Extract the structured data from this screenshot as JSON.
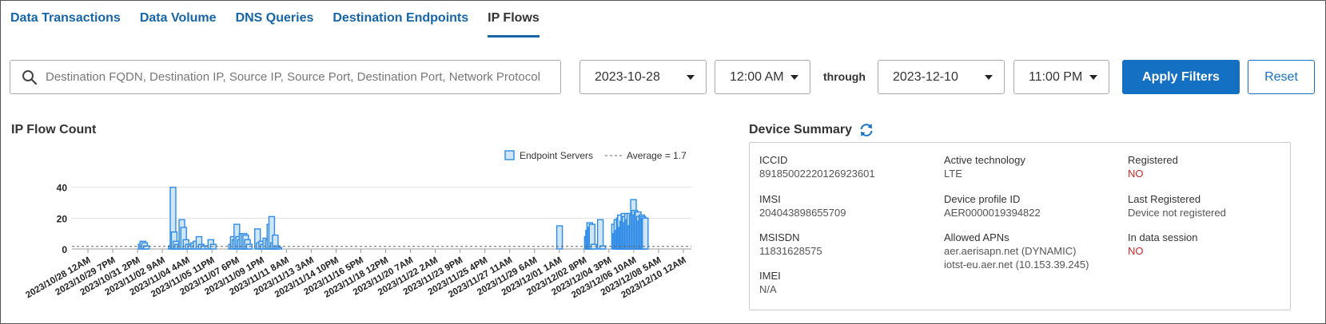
{
  "tabs": [
    {
      "label": "Data Transactions",
      "active": false
    },
    {
      "label": "Data Volume",
      "active": false
    },
    {
      "label": "DNS Queries",
      "active": false
    },
    {
      "label": "Destination Endpoints",
      "active": false
    },
    {
      "label": "IP Flows",
      "active": true
    }
  ],
  "filters": {
    "search_placeholder": "Destination FQDN, Destination IP, Source IP, Source Port, Destination Port, Network Protocol",
    "start_date": "2023-10-28",
    "start_time": "12:00 AM",
    "through_label": "through",
    "end_date": "2023-12-10",
    "end_time": "11:00 PM",
    "apply_label": "Apply Filters",
    "reset_label": "Reset"
  },
  "chart": {
    "title": "IP Flow Count"
  },
  "chart_data": {
    "type": "bar",
    "title": "IP Flow Count",
    "legend": [
      {
        "name": "Endpoint Servers",
        "style": "bar"
      },
      {
        "name": "Average = 1.7",
        "style": "dashed-line"
      }
    ],
    "legend_position": "top-right",
    "ylim": [
      0,
      45
    ],
    "yticks": [
      0,
      20,
      40
    ],
    "grid": true,
    "x_tick_labels": [
      "2023/10/28 12AM",
      "2023/10/29 7PM",
      "2023/10/31 2PM",
      "2023/11/02 9AM",
      "2023/11/04 4AM",
      "2023/11/05 11PM",
      "2023/11/07 6PM",
      "2023/11/09 1PM",
      "2023/11/11 8AM",
      "2023/11/13 3AM",
      "2023/11/14 10PM",
      "2023/11/16 5PM",
      "2023/11/18 12PM",
      "2023/11/20 7AM",
      "2023/11/22 2AM",
      "2023/11/23 9PM",
      "2023/11/25 4PM",
      "2023/11/27 11AM",
      "2023/11/29 6AM",
      "2023/12/01 1AM",
      "2023/12/02 8PM",
      "2023/12/04 3PM",
      "2023/12/06 10AM",
      "2023/12/08 5AM",
      "2023/12/10 12AM"
    ],
    "x_range": [
      0,
      1048
    ],
    "x_unit": "hours since 2023/10/28 12AM",
    "series": [
      {
        "name": "Endpoint Servers",
        "points": [
          [
            117,
            3
          ],
          [
            120,
            5
          ],
          [
            123,
            4
          ],
          [
            126,
            2
          ],
          [
            168,
            2
          ],
          [
            171,
            40
          ],
          [
            173,
            11
          ],
          [
            176,
            5
          ],
          [
            179,
            3
          ],
          [
            183,
            2
          ],
          [
            186,
            19
          ],
          [
            189,
            14
          ],
          [
            193,
            6
          ],
          [
            197,
            3
          ],
          [
            201,
            2
          ],
          [
            206,
            4
          ],
          [
            210,
            5
          ],
          [
            215,
            8
          ],
          [
            219,
            3
          ],
          [
            223,
            2
          ],
          [
            230,
            2
          ],
          [
            235,
            6
          ],
          [
            239,
            3
          ],
          [
            270,
            3
          ],
          [
            273,
            8
          ],
          [
            276,
            6
          ],
          [
            279,
            16
          ],
          [
            282,
            8
          ],
          [
            285,
            6
          ],
          [
            288,
            10
          ],
          [
            291,
            10
          ],
          [
            294,
            9
          ],
          [
            297,
            6
          ],
          [
            300,
            3
          ],
          [
            314,
            13
          ],
          [
            317,
            4
          ],
          [
            321,
            5
          ],
          [
            324,
            3
          ],
          [
            328,
            7
          ],
          [
            332,
            6
          ],
          [
            335,
            16
          ],
          [
            338,
            21
          ],
          [
            341,
            4
          ],
          [
            344,
            9
          ],
          [
            347,
            2
          ],
          [
            350,
            1
          ],
          [
            825,
            15
          ],
          [
            872,
            8
          ],
          [
            874,
            12
          ],
          [
            876,
            17
          ],
          [
            878,
            14
          ],
          [
            880,
            16
          ],
          [
            883,
            3
          ],
          [
            894,
            19
          ],
          [
            898,
            2
          ],
          [
            918,
            16
          ],
          [
            920,
            10
          ],
          [
            922,
            19
          ],
          [
            924,
            12
          ],
          [
            926,
            20
          ],
          [
            928,
            22
          ],
          [
            930,
            14
          ],
          [
            932,
            18
          ],
          [
            934,
            23
          ],
          [
            936,
            21
          ],
          [
            938,
            17
          ],
          [
            940,
            23
          ],
          [
            942,
            19
          ],
          [
            944,
            23
          ],
          [
            946,
            15
          ],
          [
            948,
            22
          ],
          [
            950,
            32
          ],
          [
            952,
            25
          ],
          [
            954,
            22
          ],
          [
            956,
            24
          ],
          [
            958,
            24
          ],
          [
            960,
            21
          ],
          [
            962,
            18
          ],
          [
            964,
            22
          ],
          [
            966,
            21
          ],
          [
            968,
            20
          ],
          [
            970,
            20
          ]
        ]
      }
    ],
    "average": 1.7
  },
  "device_summary": {
    "title": "Device Summary",
    "fields": [
      {
        "label": "ICCID",
        "value": "89185002220126923601",
        "alert": false
      },
      {
        "label": "Active technology",
        "value": "LTE",
        "alert": false
      },
      {
        "label": "Registered",
        "value": "NO",
        "alert": true
      },
      {
        "label": "IMSI",
        "value": "204043898655709",
        "alert": false
      },
      {
        "label": "Device profile ID",
        "value": "AER0000019394822",
        "alert": false
      },
      {
        "label": "Last Registered",
        "value": "Device not registered",
        "alert": false
      },
      {
        "label": "MSISDN",
        "value": "11831628575",
        "alert": false
      },
      {
        "label": "Allowed APNs",
        "value": "aer.aerisapn.net (DYNAMIC)",
        "value2": "iotst-eu.aer.net (10.153.39.245)",
        "alert": false
      },
      {
        "label": "In data session",
        "value": "NO",
        "alert": true
      },
      {
        "label": "IMEI",
        "value": "N/A",
        "alert": false
      }
    ]
  },
  "colors": {
    "primary": "#1470c2",
    "tab_link": "#1565a8",
    "bar_fill": "#cfe6f9",
    "bar_stroke": "#2f8be6",
    "alert": "#c62828"
  },
  "icons": {
    "search": "search-icon",
    "caret": "chevron-down-icon",
    "refresh": "refresh-icon"
  }
}
